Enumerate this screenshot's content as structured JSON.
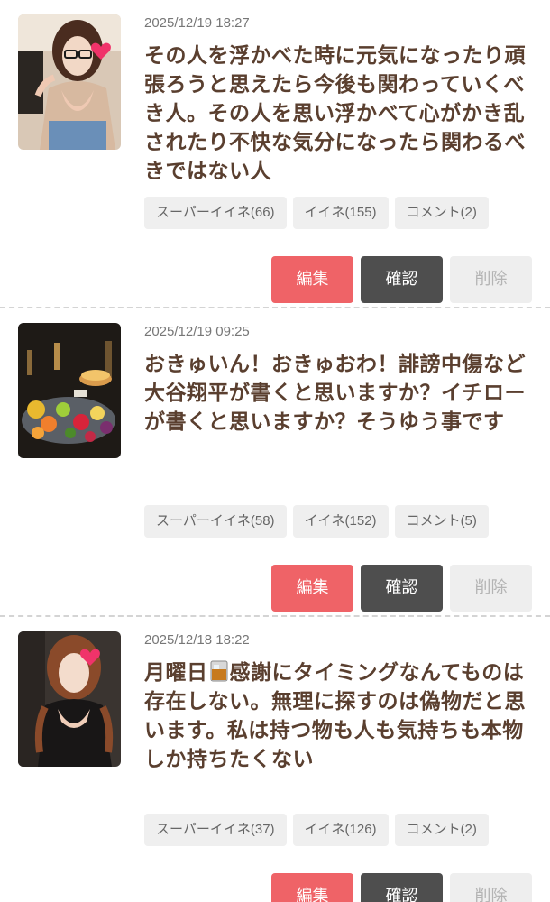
{
  "posts": [
    {
      "date": "2025/12/19 18:27",
      "text": "その人を浮かべた時に元気になったり頑張ろうと思えたら今後も関わっていくべき人。その人を思い浮かべて心がかき乱されたり不快な気分になったら関わるべきではない人",
      "super_like": "スーパーイイネ(66)",
      "like": "イイネ(155)",
      "comment": "コメント(2)",
      "thumb": "woman-glasses-photo"
    },
    {
      "date": "2025/12/19 09:25",
      "text": "おきゅいん！おきゅおわ！誹謗中傷など大谷翔平が書くと思いますか？イチローが書くと思いますか？そうゆう事です",
      "super_like": "スーパーイイネ(58)",
      "like": "イイネ(152)",
      "comment": "コメント(5)",
      "thumb": "fruit-platter-photo"
    },
    {
      "date": "2025/12/18 18:22",
      "text_before_emoji": "月曜日",
      "emoji": "whisky-glass-icon",
      "text": "感謝にタイミングなんてものは存在しない。無理に探すのは偽物だと思います。私は持つ物も人も気持ちも本物しか持ちたくない",
      "super_like": "スーパーイイネ(37)",
      "like": "イイネ(126)",
      "comment": "コメント(2)",
      "thumb": "woman-dark-dress-photo"
    }
  ],
  "buttons": {
    "edit": "編集",
    "confirm": "確認",
    "delete": "削除"
  },
  "colors": {
    "text": "#5a3f2f",
    "edit": "#ef6367",
    "confirm": "#4e4e4e",
    "delete_bg": "#eeeeee",
    "chip_bg": "#efefef",
    "sticker": "#f0336a"
  }
}
